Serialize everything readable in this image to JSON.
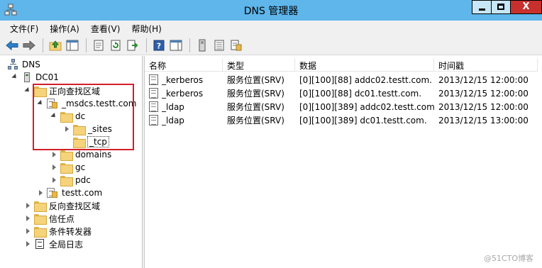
{
  "window": {
    "title": "DNS 管理器",
    "icons": {
      "app": "dns-app-icon",
      "minimize": "minimize-icon",
      "maximize": "maximize-icon",
      "close": "close-icon"
    },
    "close_glyph": "X",
    "accent": "#5eb6ea",
    "close_color": "#c7302d"
  },
  "menu": {
    "file": "文件(F)",
    "action": "操作(A)",
    "view": "查看(V)",
    "help": "帮助(H)"
  },
  "toolbar": {
    "buttons": [
      "back-arrow-icon",
      "forward-arrow-icon",
      "up-folder-icon",
      "show-console-tree-icon",
      "properties-icon",
      "refresh-icon",
      "export-list-icon",
      "help-icon",
      "action-pane-icon",
      "server-icon",
      "list-icon",
      "zone-icon"
    ]
  },
  "tree": {
    "root": "DNS",
    "server": "DC01",
    "forward_zones": "正向查找区域",
    "msdcs_zone": "_msdcs.testt.com",
    "dc": "dc",
    "sites": "_sites",
    "tcp": "_tcp",
    "domains": "domains",
    "gc": "gc",
    "pdc": "pdc",
    "testt_zone": "testt.com",
    "reverse_zones": "反向查找区域",
    "trust_points": "信任点",
    "conditional_forwarders": "条件转发器",
    "global_logs": "全局日志",
    "highlight_color": "#d3202a"
  },
  "list": {
    "columns": [
      "名称",
      "类型",
      "数据",
      "时间戳"
    ],
    "rows": [
      {
        "name": "_kerberos",
        "type": "服务位置(SRV)",
        "data": "[0][100][88] addc02.testt.com.",
        "timestamp": "2013/12/15 12:00:00"
      },
      {
        "name": "_kerberos",
        "type": "服务位置(SRV)",
        "data": "[0][100][88] dc01.testt.com.",
        "timestamp": "2013/12/15 12:00:00"
      },
      {
        "name": "_ldap",
        "type": "服务位置(SRV)",
        "data": "[0][100][389] addc02.testt.com.",
        "timestamp": "2013/12/15 12:00:00"
      },
      {
        "name": "_ldap",
        "type": "服务位置(SRV)",
        "data": "[0][100][389] dc01.testt.com.",
        "timestamp": "2013/12/15 13:00:00"
      }
    ]
  },
  "watermark": "@51CTO博客"
}
